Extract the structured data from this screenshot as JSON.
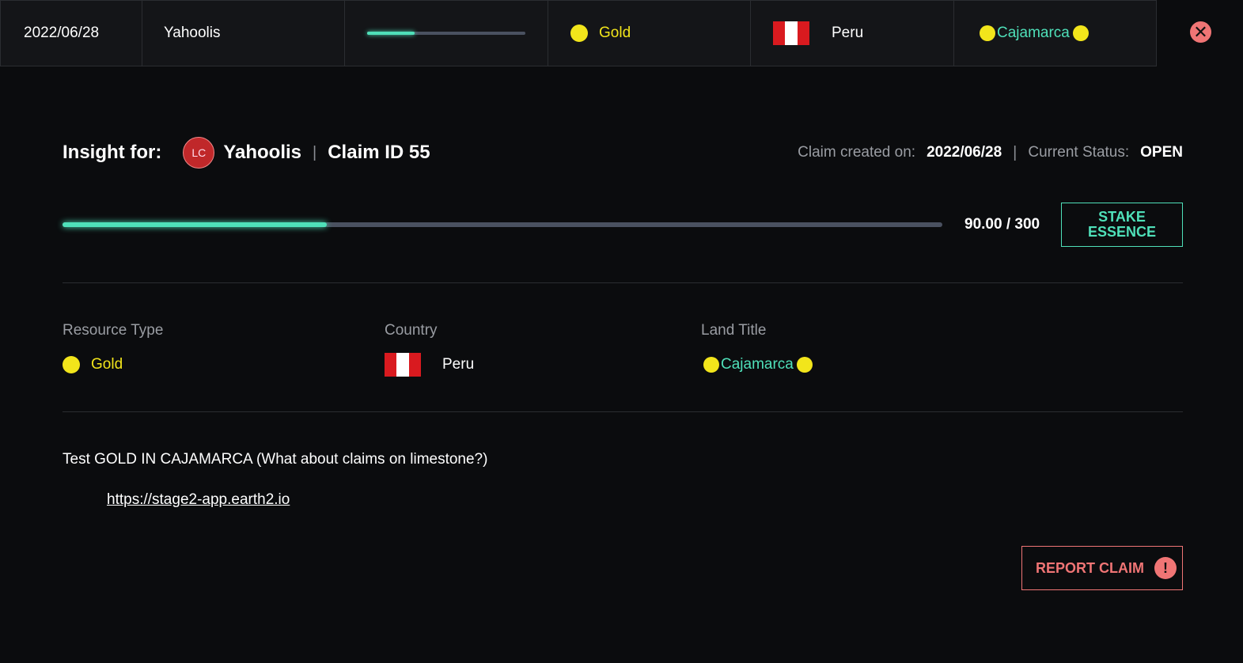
{
  "topbar": {
    "date": "2022/06/28",
    "user": "Yahoolis",
    "progress_fraction": 0.3,
    "resource": "Gold",
    "country": "Peru",
    "land_title": "Cajamarca"
  },
  "header": {
    "insight_label": "Insight for:",
    "avatar_initials": "LC",
    "user": "Yahoolis",
    "separator": "|",
    "claim": "Claim ID 55",
    "created_label": "Claim created on:",
    "created_date": "2022/06/28",
    "status_label": "Current Status:",
    "status": "OPEN"
  },
  "progress": {
    "text": "90.00 / 300",
    "fraction": 0.3,
    "stake_label_1": "STAKE",
    "stake_label_2": "ESSENCE"
  },
  "fields": {
    "resource_label": "Resource Type",
    "resource_value": "Gold",
    "country_label": "Country",
    "country_value": "Peru",
    "land_label": "Land Title",
    "land_value": "Cajamarca"
  },
  "description": "Test GOLD IN CAJAMARCA (What about claims on limestone?)",
  "link": "https://stage2-app.earth2.io",
  "report": {
    "label": "REPORT CLAIM",
    "icon": "!"
  },
  "close_icon": "✕",
  "colors": {
    "accent": "#4fe0b9",
    "gold": "#f2e51b",
    "danger": "#f07575",
    "background": "#0b0c0e"
  }
}
